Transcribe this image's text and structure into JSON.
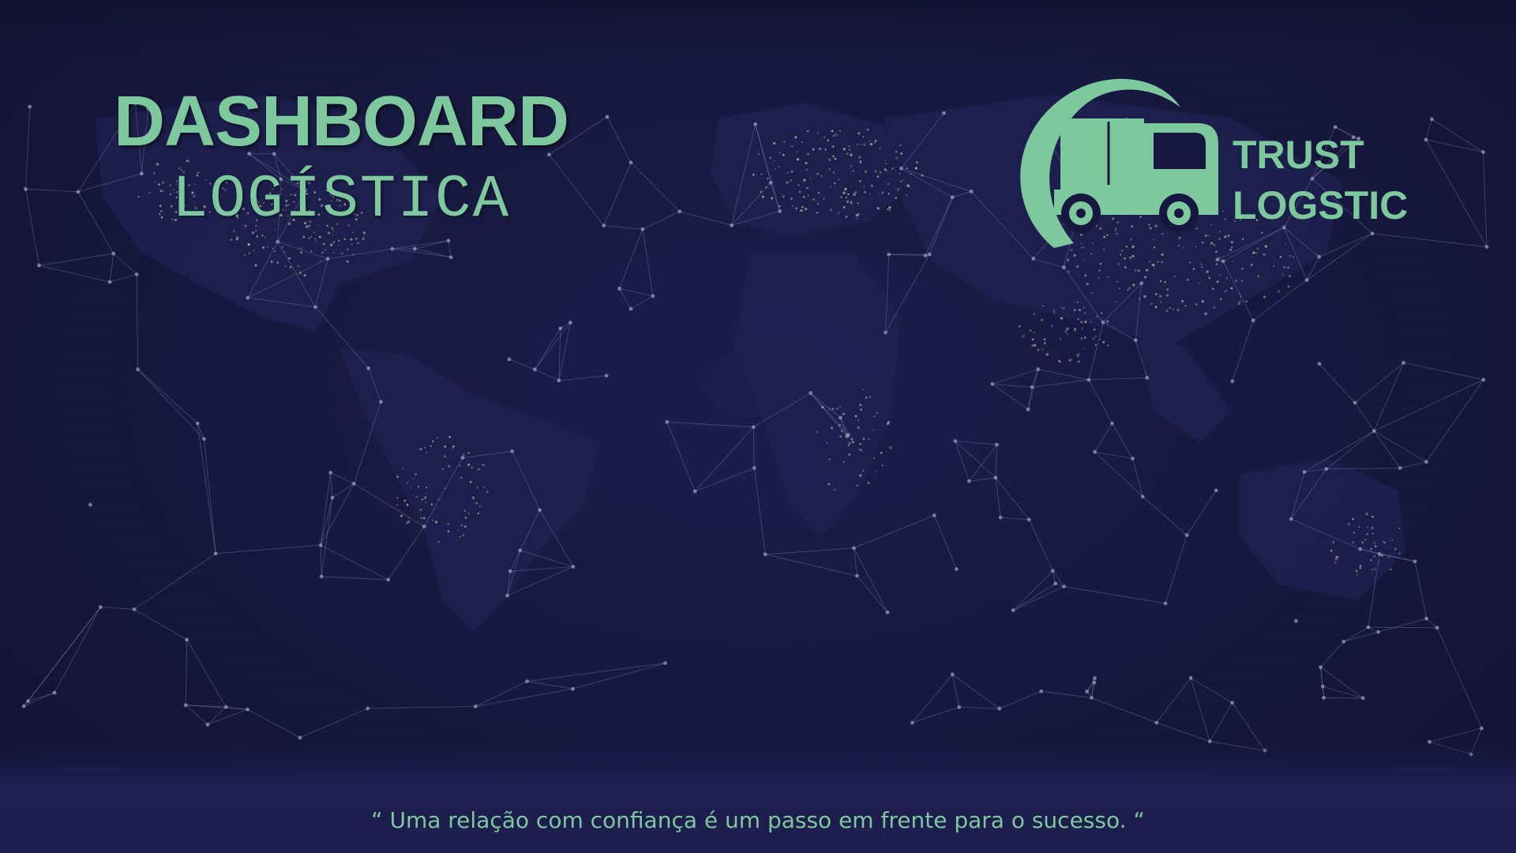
{
  "title": {
    "main": "DASHBOARD",
    "sub": "LOGÍSTICA"
  },
  "logo": {
    "line1": "TRUST",
    "line2": "LOGSTIC",
    "icon": "truck-icon"
  },
  "quote": "“ Uma relação com confiança é um passo em frente para o sucesso. “",
  "colors": {
    "accent": "#7ec89e",
    "background": "#17183f",
    "network_line": "#8a8fb4",
    "city_lights": "#c9c7a2"
  }
}
